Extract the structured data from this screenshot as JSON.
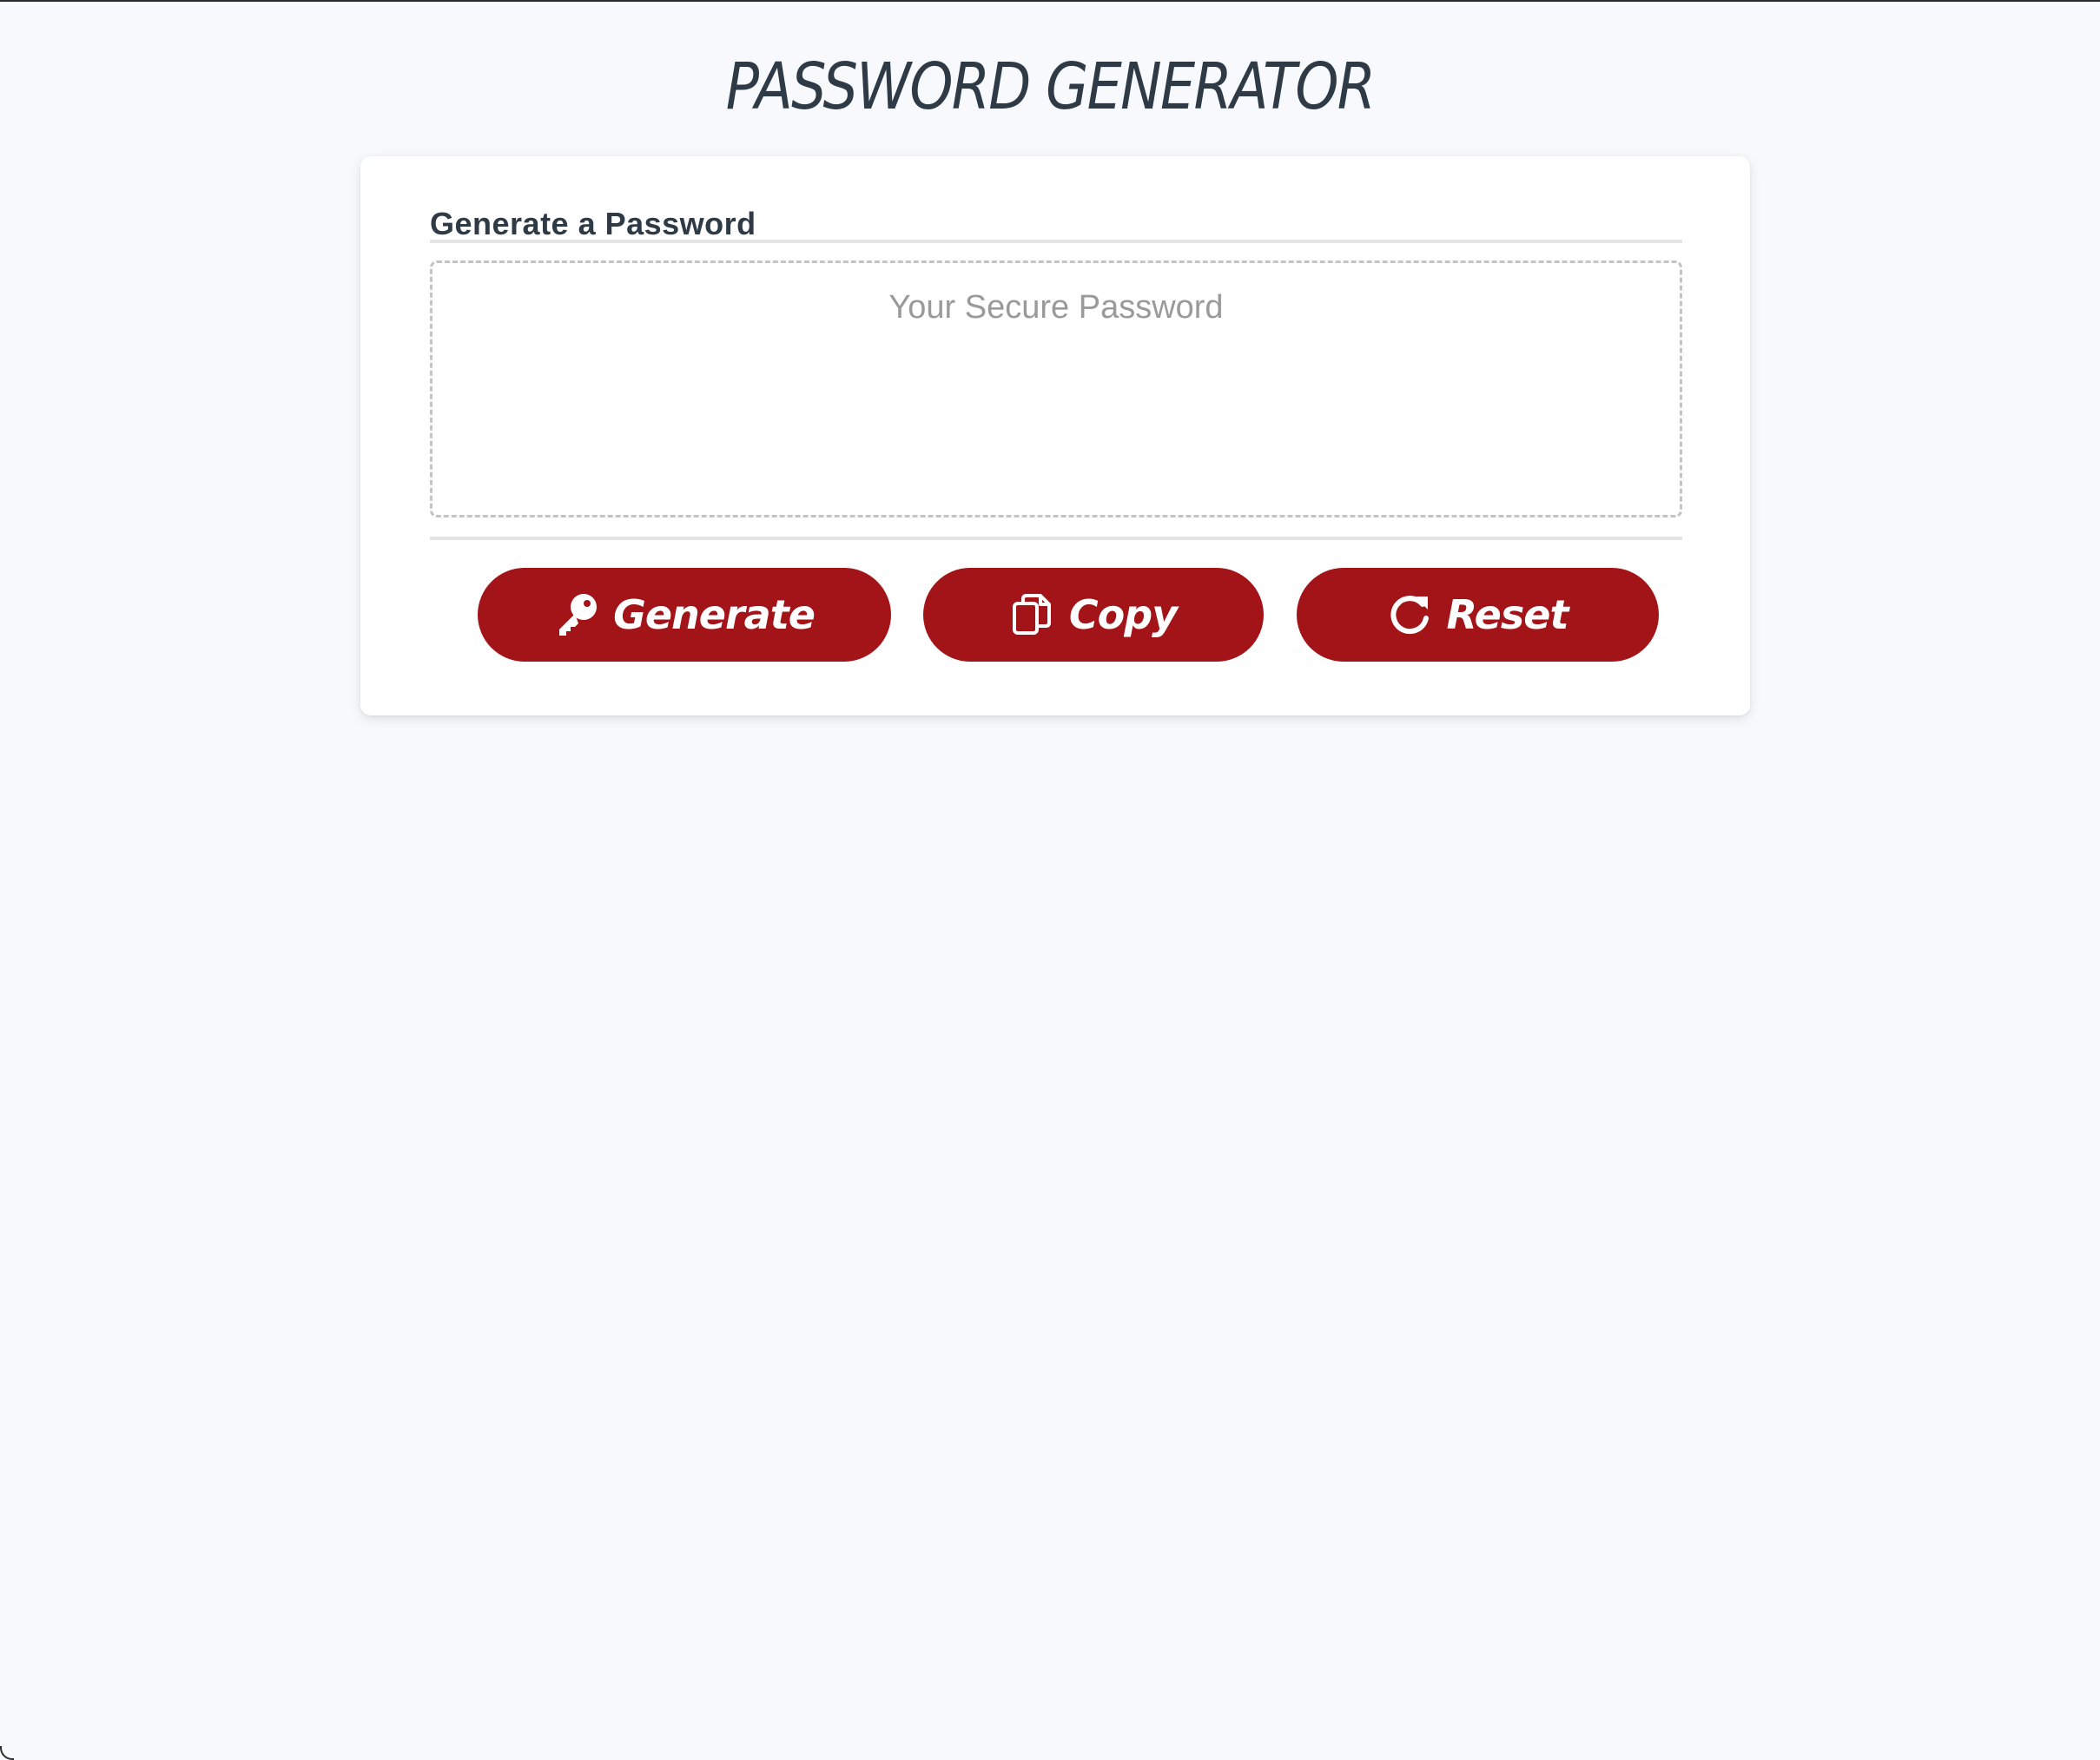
{
  "page": {
    "title": "PASSWORD GENERATOR"
  },
  "card": {
    "title": "Generate a Password",
    "password_placeholder": "Your Secure Password",
    "password_value": ""
  },
  "buttons": {
    "generate": {
      "label": "Generate",
      "icon": "key-icon"
    },
    "copy": {
      "label": "Copy",
      "icon": "copy-icon"
    },
    "reset": {
      "label": "Reset",
      "icon": "redo-icon"
    }
  },
  "colors": {
    "background": "#f8f9fc",
    "card": "#ffffff",
    "title_text": "#2e3a46",
    "button": "#a31419",
    "button_text": "#ffffff",
    "placeholder": "#9a9a9a",
    "dashed_border": "#c4c4c4"
  }
}
